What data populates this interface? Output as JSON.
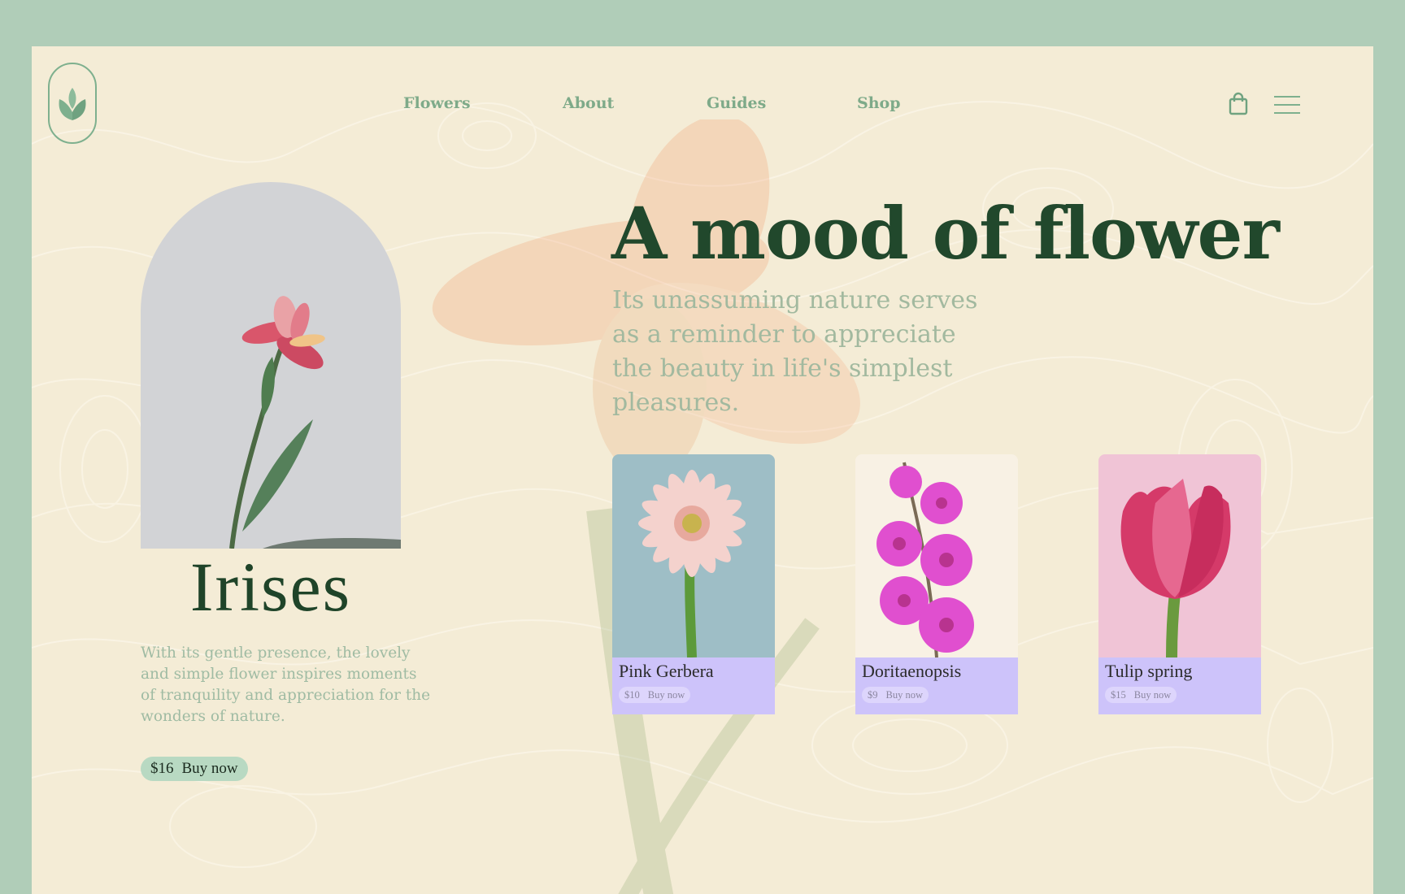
{
  "nav": {
    "items": [
      {
        "label": "Flowers"
      },
      {
        "label": "About"
      },
      {
        "label": "Guides"
      },
      {
        "label": "Shop"
      }
    ]
  },
  "featured": {
    "name": "Irises",
    "description": "With its gentle presence, the lovely and simple flower inspires moments of tranquility and appreciation for the wonders of nature.",
    "price": "$16",
    "buy_label": "Buy now"
  },
  "hero": {
    "title": "A mood of flower",
    "subtitle": "Its unassuming nature serves as a reminder to appreciate the beauty in life's simplest pleasures."
  },
  "products": [
    {
      "name": "Pink Gerbera",
      "price": "$10",
      "buy_label": "Buy now"
    },
    {
      "name": "Doritaenopsis",
      "price": "$9",
      "buy_label": "Buy now"
    },
    {
      "name": "Tulip spring",
      "price": "$15",
      "buy_label": "Buy now"
    }
  ],
  "colors": {
    "outer_background": "#b0cdb8",
    "page_background": "#f4ecd6",
    "accent_green": "#7eb08e",
    "title_green": "#21482c",
    "card_lavender": "#cdc3fa",
    "button_mint": "#b8d9c2"
  },
  "icons": {
    "logo": "tulip-logo-icon",
    "cart": "shopping-bag-icon",
    "menu": "hamburger-menu-icon"
  }
}
